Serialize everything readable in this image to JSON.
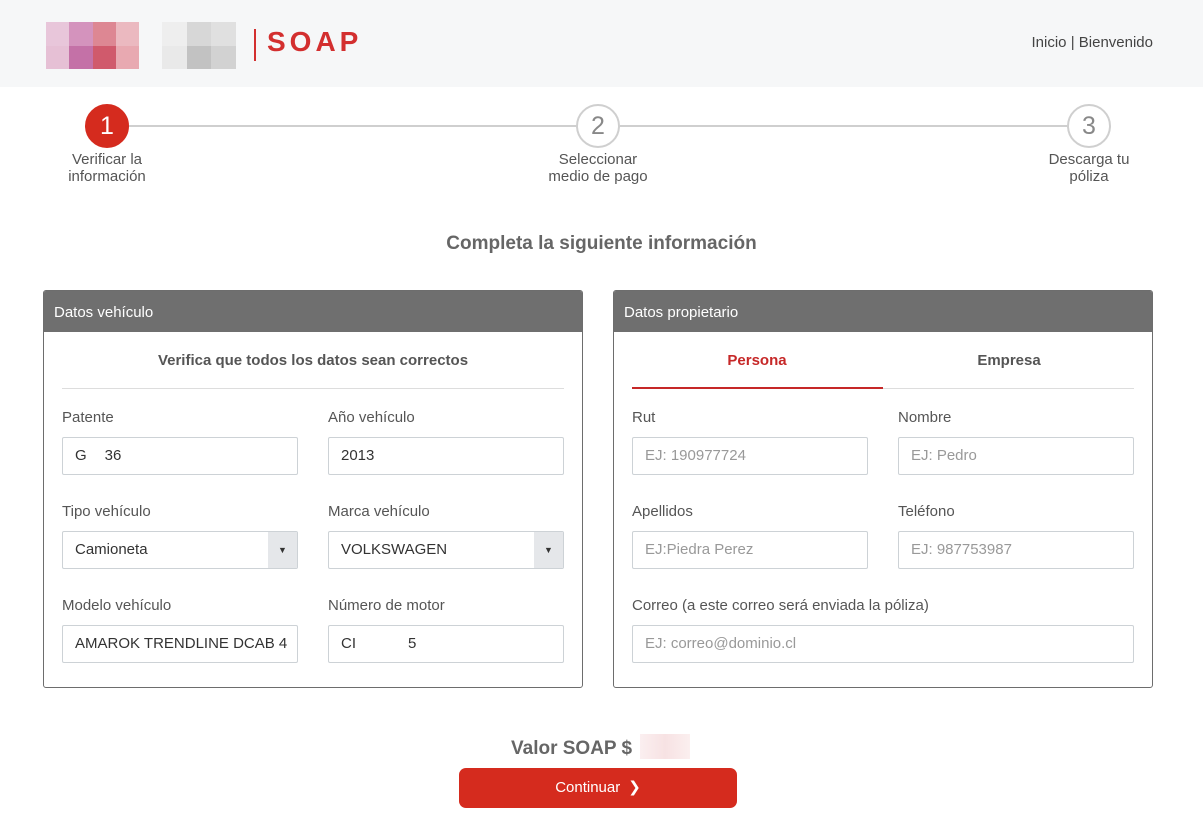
{
  "header": {
    "logo_text": "SOAP",
    "nav_home": "Inicio",
    "nav_separator": "|",
    "nav_welcome": "Bienvenido"
  },
  "stepper": {
    "steps": [
      {
        "number": "1",
        "label_line1": "Verificar la",
        "label_line2": "información"
      },
      {
        "number": "2",
        "label_line1": "Seleccionar",
        "label_line2": "medio de pago"
      },
      {
        "number": "3",
        "label_line1": "Descarga tu",
        "label_line2": "póliza"
      }
    ],
    "active_step": 1
  },
  "main_title": "Completa la siguiente información",
  "vehicle": {
    "heading": "Datos vehículo",
    "verify_text": "Verifica que todos los datos sean correctos",
    "patente_label": "Patente",
    "patente_value_start": "G",
    "patente_value_end": "36",
    "anio_label": "Año vehículo",
    "anio_value": "2013",
    "tipo_label": "Tipo vehículo",
    "tipo_value": "Camioneta",
    "marca_label": "Marca vehículo",
    "marca_value": "VOLKSWAGEN",
    "modelo_label": "Modelo vehículo",
    "modelo_value": "AMAROK TRENDLINE DCAB 4",
    "motor_label": "Número de motor",
    "motor_value_start": "CI",
    "motor_value_end": "5"
  },
  "owner": {
    "heading": "Datos propietario",
    "tab_persona": "Persona",
    "tab_empresa": "Empresa",
    "rut_label": "Rut",
    "rut_placeholder": "EJ: 190977724",
    "nombre_label": "Nombre",
    "nombre_placeholder": "EJ: Pedro",
    "apellidos_label": "Apellidos",
    "apellidos_placeholder": "EJ:Piedra Perez",
    "telefono_label": "Teléfono",
    "telefono_placeholder": "EJ: 987753987",
    "correo_label": "Correo (a este correo será enviada la póliza)",
    "correo_placeholder": "EJ: correo@dominio.cl"
  },
  "footer": {
    "price_label": "Valor SOAP $",
    "continue_label": "Continuar"
  },
  "colors": {
    "brand_red": "#d52b1e",
    "panel_header": "#6f6f6f"
  }
}
